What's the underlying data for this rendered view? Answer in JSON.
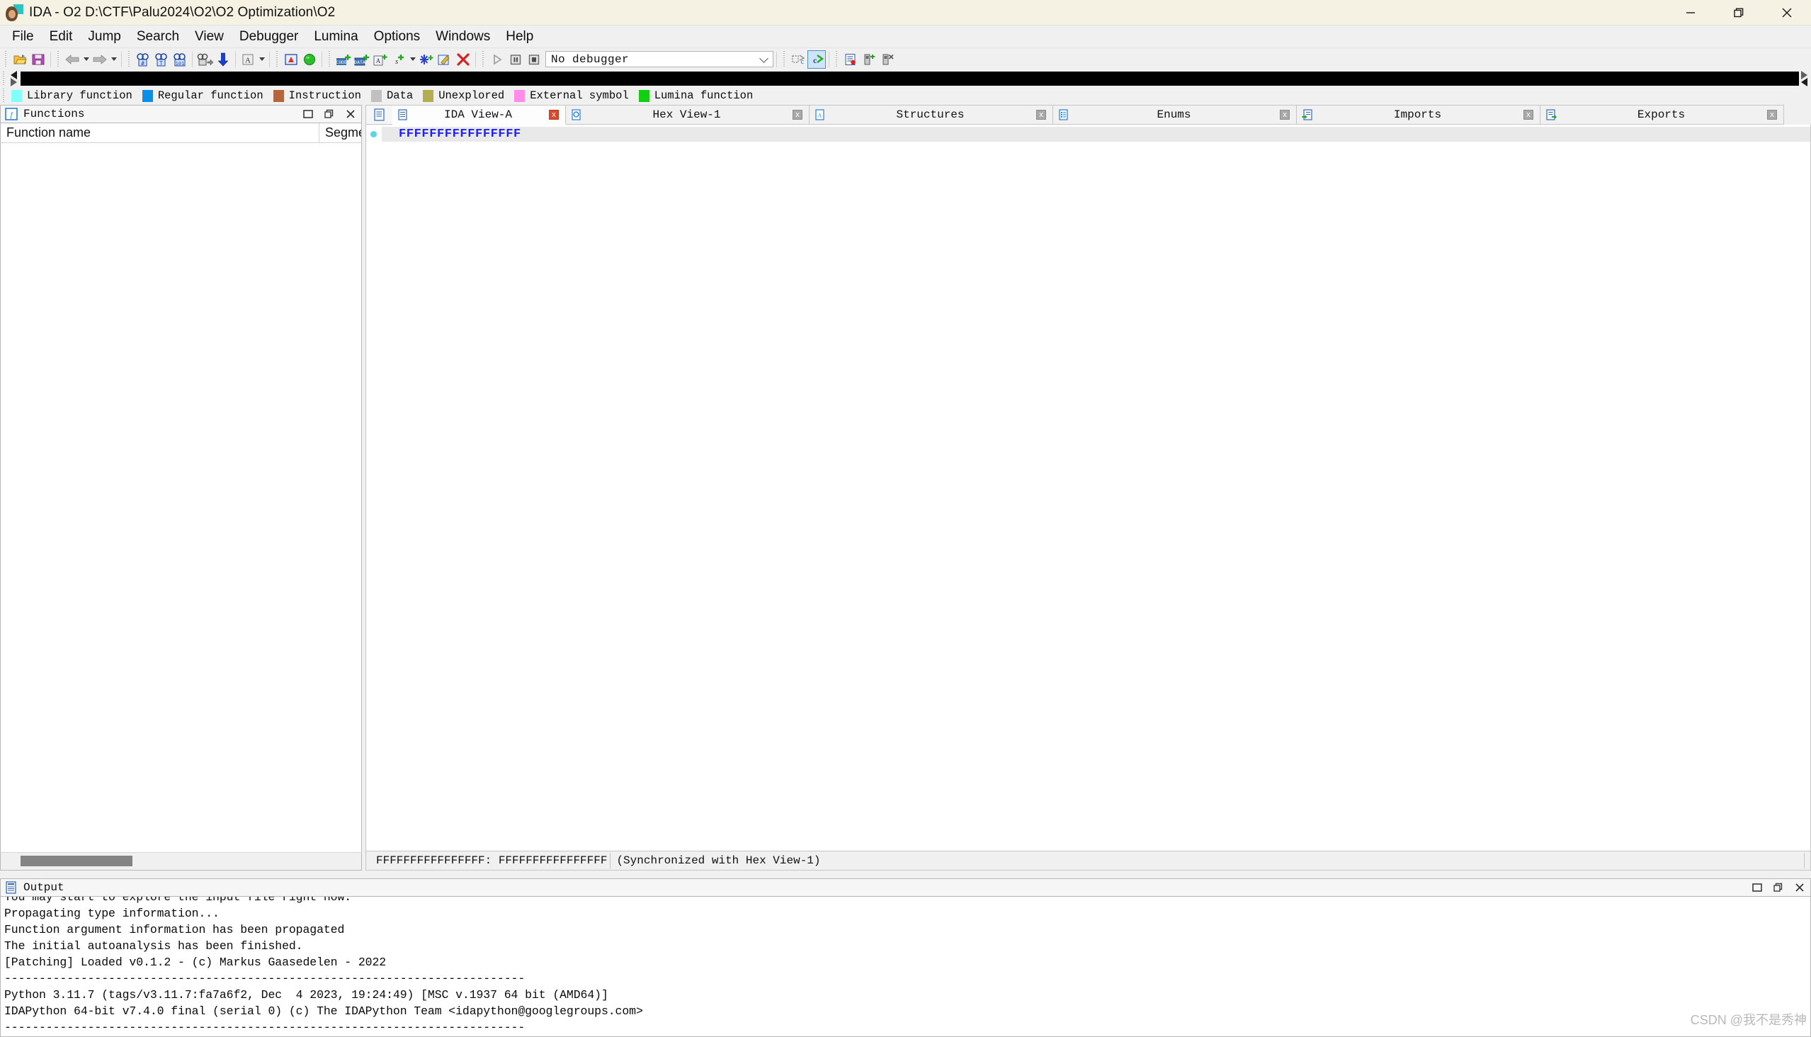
{
  "window": {
    "title": "IDA - O2 D:\\CTF\\Palu2024\\O2\\O2 Optimization\\O2",
    "app_icon": "ida-logo-icon",
    "controls": {
      "minimize": "minimize-icon",
      "restore": "restore-icon",
      "close": "close-icon"
    }
  },
  "menubar": {
    "items": [
      {
        "label": "File"
      },
      {
        "label": "Edit"
      },
      {
        "label": "Jump"
      },
      {
        "label": "Search"
      },
      {
        "label": "View"
      },
      {
        "label": "Debugger"
      },
      {
        "label": "Lumina"
      },
      {
        "label": "Options"
      },
      {
        "label": "Windows"
      },
      {
        "label": "Help"
      }
    ]
  },
  "toolbar": {
    "debugger_select": {
      "value": "No debugger",
      "chevron": "chevron-down-icon"
    },
    "icons": [
      "open-file-icon",
      "save-icon",
      "back-arrow-icon",
      "forward-arrow-icon",
      "search-hash-icon",
      "search-text-icon",
      "search-binary-icon",
      "jump-icon",
      "down-arrow-icon",
      "rename-icon",
      "warning-icon",
      "play-green-icon",
      "make-code-icon",
      "make-data-icon",
      "make-ascii-icon",
      "make-struct-icon",
      "make-unknown-icon",
      "edit-function-icon",
      "delete-icon",
      "run-icon",
      "pause-icon",
      "stop-icon",
      "step-into-icon",
      "step-over-icon",
      "breakpoint-list-icon",
      "add-breakpoint-icon",
      "del-breakpoint-icon"
    ]
  },
  "navband": {
    "left_arrows": "nav-left-arrows-icon",
    "right_arrows": "nav-right-arrows-icon",
    "band_color": "#000000"
  },
  "legend": {
    "items": [
      {
        "label": "Library function",
        "color": "#82fffb"
      },
      {
        "label": "Regular function",
        "color": "#0a8fe8"
      },
      {
        "label": "Instruction",
        "color": "#b5653d"
      },
      {
        "label": "Data",
        "color": "#c0c0c0"
      },
      {
        "label": "Unexplored",
        "color": "#b0ae50"
      },
      {
        "label": "External symbol",
        "color": "#ff8ce8"
      },
      {
        "label": "Lumina function",
        "color": "#12cf12"
      }
    ]
  },
  "functions_panel": {
    "icon": "function-f-icon",
    "title": "Functions",
    "columns": [
      {
        "label": "Function name"
      },
      {
        "label": "Segme"
      }
    ],
    "rows": [],
    "window_buttons": {
      "maximize": "maximize-icon",
      "restore": "restore-icon",
      "close": "close-icon"
    }
  },
  "tabs": [
    {
      "label": "IDA View-A",
      "icon": "ida-view-icon",
      "active": true,
      "close": "x"
    },
    {
      "label": "Hex View-1",
      "icon": "hex-view-icon",
      "active": false,
      "close": "x"
    },
    {
      "label": "Structures",
      "icon": "structures-icon",
      "active": false,
      "close": "x"
    },
    {
      "label": "Enums",
      "icon": "enums-icon",
      "active": false,
      "close": "x"
    },
    {
      "label": "Imports",
      "icon": "imports-icon",
      "active": false,
      "close": "x"
    },
    {
      "label": "Exports",
      "icon": "exports-icon",
      "active": false,
      "close": "x"
    }
  ],
  "disassembly": {
    "marker": "cyan-dot-marker",
    "line_text": "FFFFFFFFFFFFFFFF",
    "line_color": "#2020ff",
    "status_address": "FFFFFFFFFFFFFFFF: FFFFFFFFFFFFFFFF",
    "status_sync": "(Synchronized with Hex View-1)"
  },
  "output_panel": {
    "icon": "output-icon",
    "title": "Output",
    "window_buttons": {
      "maximize": "maximize-icon",
      "restore": "restore-icon",
      "close": "close-icon"
    },
    "lines": [
      "You may start to explore the input file right now.",
      "Propagating type information...",
      "Function argument information has been propagated",
      "The initial autoanalysis has been finished.",
      "[Patching] Loaded v0.1.2 - (c) Markus Gaasedelen - 2022",
      "---------------------------------------------------------------------------",
      "Python 3.11.7 (tags/v3.11.7:fa7a6f2, Dec  4 2023, 19:24:49) [MSC v.1937 64 bit (AMD64)]",
      "IDAPython 64-bit v7.4.0 final (serial 0) (c) The IDAPython Team <idapython@googlegroups.com>",
      "---------------------------------------------------------------------------"
    ]
  },
  "watermark": {
    "text": "CSDN @我不是秀神"
  }
}
